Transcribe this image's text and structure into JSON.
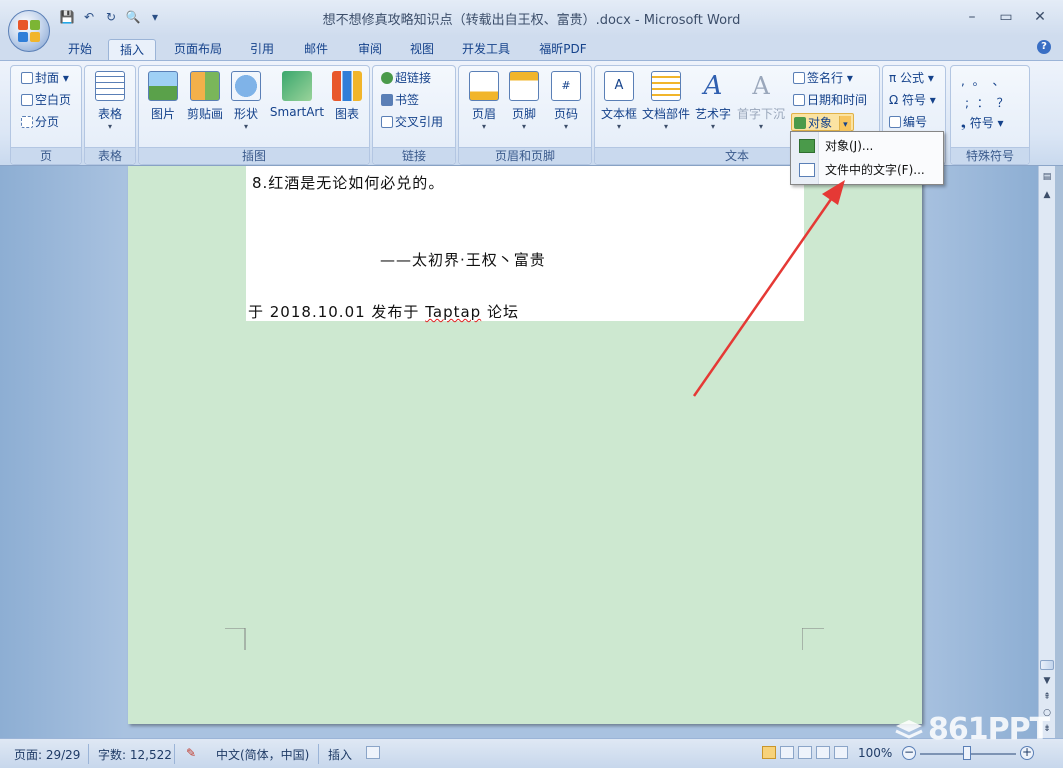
{
  "window": {
    "title": "想不想修真攻略知识点（转载出自王权、富贵）.docx - Microsoft Word",
    "minimize": "–",
    "maximize": "▭",
    "close": "✕"
  },
  "qat": {
    "save": "💾",
    "undo": "↶",
    "redo": "↻",
    "preview": "🔍",
    "customize": "▾"
  },
  "tabs": [
    {
      "label": "开始"
    },
    {
      "label": "插入"
    },
    {
      "label": "页面布局"
    },
    {
      "label": "引用"
    },
    {
      "label": "邮件"
    },
    {
      "label": "审阅"
    },
    {
      "label": "视图"
    },
    {
      "label": "开发工具"
    },
    {
      "label": "福昕PDF"
    }
  ],
  "ribbon": {
    "pages": {
      "label": "页",
      "cover": "封面 ▾",
      "blank": "空白页",
      "break": "分页"
    },
    "tables": {
      "label": "表格",
      "table": "表格"
    },
    "illustrations": {
      "label": "插图",
      "picture": "图片",
      "clipart": "剪贴画",
      "shapes": "形状",
      "smartart": "SmartArt",
      "chart": "图表"
    },
    "links": {
      "label": "链接",
      "hyperlink": "超链接",
      "bookmark": "书签",
      "crossref": "交叉引用"
    },
    "headerfooter": {
      "label": "页眉和页脚",
      "header": "页眉",
      "footer": "页脚",
      "pagenum": "页码"
    },
    "text": {
      "label": "文本",
      "textbox": "文本框",
      "quickparts": "文档部件",
      "wordart": "艺术字",
      "dropcap": "首字下沉",
      "signature": "签名行 ▾",
      "datetime": "日期和时间",
      "object": "对象"
    },
    "symbols": {
      "equation": "π 公式 ▾",
      "symbol": "Ω 符号 ▾",
      "numbering": "编号"
    },
    "special": {
      "label": "特殊符号",
      "row1": ",  。  、",
      "row2": ";  ：  ？",
      "symbol": "符号 ▾"
    }
  },
  "object_menu": {
    "item1": "对象(J)...",
    "item2": "文件中的文字(F)..."
  },
  "document": {
    "line1": "8.红酒是无论如何必兑的。",
    "line2": "——太初界·王权丶富贵",
    "line3_prefix": "于 2018.10.01 发布于 ",
    "line3_link": "Taptap",
    "line3_suffix": " 论坛"
  },
  "status": {
    "page": "页面: 29/29",
    "words": "字数: 12,522",
    "language": "中文(简体，中国)",
    "mode": "插入",
    "zoom": "100%"
  },
  "watermark": "861PPT",
  "colors": {
    "page_bg": "#cde8d0",
    "ribbon_text": "#15428b",
    "arrow": "#e53935"
  }
}
